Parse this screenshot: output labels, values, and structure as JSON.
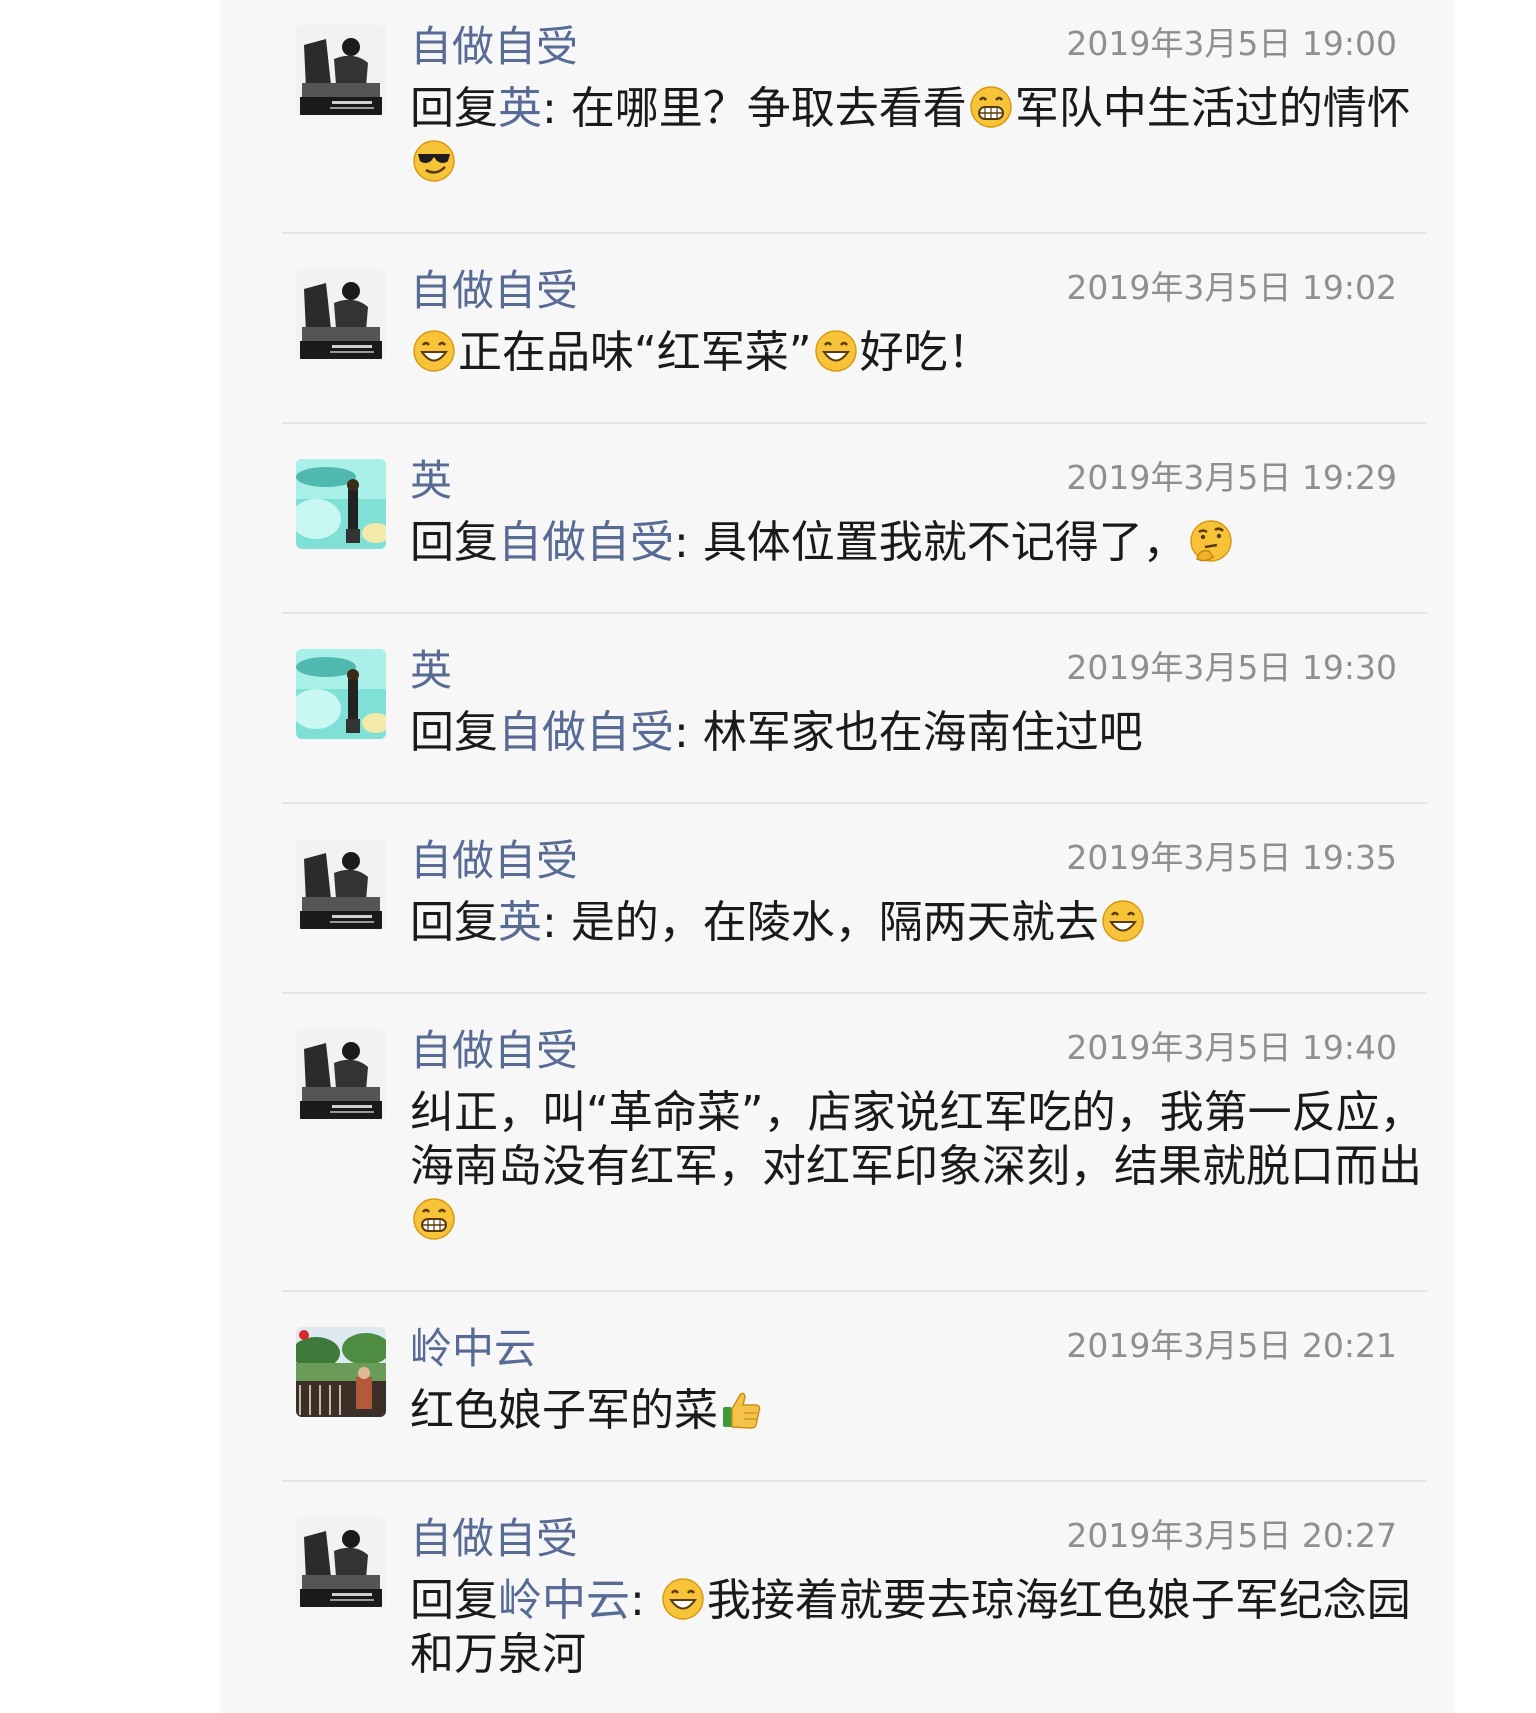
{
  "comments": [
    {
      "avatar": "bw-photo-avatar",
      "name": "自做自受",
      "time": "2019年3月5日 19:00",
      "reply_prefix": "回复",
      "reply_to": "英",
      "colon": ": ",
      "parts": [
        "在哪里？争取去看看",
        "军队中生活过的情怀",
        ""
      ],
      "emojis": [
        "grin-emoji",
        "cool-emoji"
      ]
    },
    {
      "avatar": "bw-photo-avatar",
      "name": "自做自受",
      "time": "2019年3月5日 19:02",
      "parts": [
        "",
        "正在品味“红军菜”",
        "好吃！"
      ],
      "emojis": [
        "smile-emoji",
        "smile-emoji"
      ]
    },
    {
      "avatar": "teal-photo-avatar",
      "name": "英",
      "time": "2019年3月5日 19:29",
      "reply_prefix": "回复",
      "reply_to": "自做自受",
      "colon": ": ",
      "parts": [
        "具体位置我就不记得了，",
        ""
      ],
      "emojis": [
        "thinking-emoji"
      ]
    },
    {
      "avatar": "teal-photo-avatar",
      "name": "英",
      "time": "2019年3月5日 19:30",
      "reply_prefix": "回复",
      "reply_to": "自做自受",
      "colon": ": ",
      "parts": [
        "林军家也在海南住过吧"
      ],
      "emojis": []
    },
    {
      "avatar": "bw-photo-avatar",
      "name": "自做自受",
      "time": "2019年3月5日 19:35",
      "reply_prefix": "回复",
      "reply_to": "英",
      "colon": ": ",
      "parts": [
        "是的，在陵水，隔两天就去",
        ""
      ],
      "emojis": [
        "smile-emoji"
      ]
    },
    {
      "avatar": "bw-photo-avatar",
      "name": "自做自受",
      "time": "2019年3月5日 19:40",
      "parts": [
        "纠正，叫“革命菜”，店家说红军吃的，我第一反应，海南岛没有红军，对红军印象深刻，结果就脱口而出",
        ""
      ],
      "emojis": [
        "grin-emoji"
      ]
    },
    {
      "avatar": "garden-photo-avatar",
      "name": "岭中云",
      "time": "2019年3月5日 20:21",
      "parts": [
        "红色娘子军的菜",
        ""
      ],
      "emojis": [
        "thumbs-up-emoji"
      ]
    },
    {
      "avatar": "bw-photo-avatar",
      "name": "自做自受",
      "time": "2019年3月5日 20:27",
      "reply_prefix": "回复",
      "reply_to": "岭中云",
      "colon": ": ",
      "parts": [
        "",
        "我接着就要去琼海红色娘子军纪念园和万泉河"
      ],
      "emojis": [
        "smile-emoji"
      ]
    }
  ]
}
